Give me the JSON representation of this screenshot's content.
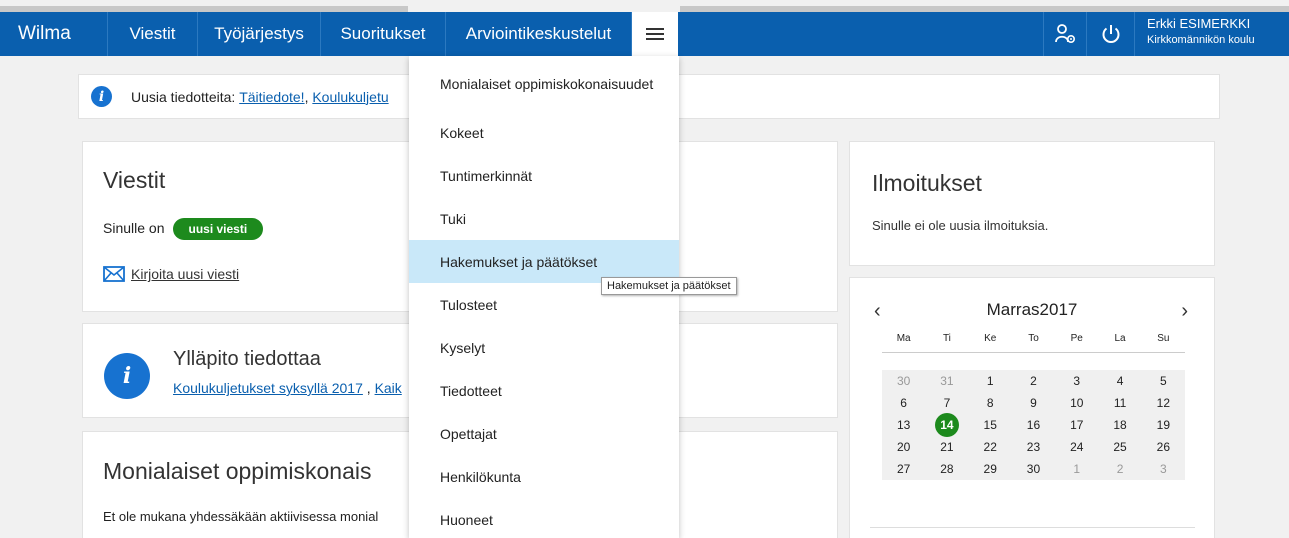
{
  "nav": {
    "brand": "Wilma",
    "items": [
      "Viestit",
      "Työjärjestys",
      "Suoritukset",
      "Arviointikeskustelut"
    ],
    "user_name": "Erkki ESIMERKKI",
    "user_school": "Kirkkomännikön koulu"
  },
  "notice": {
    "prefix": "Uusia tiedotteita:",
    "link1": "Täitiedote!",
    "sep": ",",
    "link2": "Koulukuljetu"
  },
  "messages": {
    "title": "Viestit",
    "text": "Sinulle on",
    "badge": "uusi viesti",
    "compose": "Kirjoita uusi viesti"
  },
  "admin": {
    "title": "Ylläpito tiedottaa",
    "link1": "Koulukuljetukset syksyllä 2017",
    "sep": ",",
    "link2": "Kaik"
  },
  "multi": {
    "title": "Monialaiset oppimiskonais",
    "text": "Et ole mukana yhdessäkään aktiivisessa monial"
  },
  "notifications": {
    "title": "Ilmoitukset",
    "text": "Sinulle ei ole uusia ilmoituksia."
  },
  "dropdown": {
    "items": [
      "Monialaiset oppimiskokonaisuudet",
      "Kokeet",
      "Tuntimerkinnät",
      "Tuki",
      "Hakemukset ja päätökset",
      "Tulosteet",
      "Kyselyt",
      "Tiedotteet",
      "Opettajat",
      "Henkilökunta",
      "Huoneet"
    ],
    "tooltip": "Hakemukset ja päätökset"
  },
  "calendar": {
    "month": "Marras",
    "year": "2017",
    "prev": "‹",
    "next": "›",
    "dow": [
      "Ma",
      "Ti",
      "Ke",
      "To",
      "Pe",
      "La",
      "Su"
    ],
    "weeks": [
      [
        "30",
        "31",
        "1",
        "2",
        "3",
        "4",
        "5"
      ],
      [
        "6",
        "7",
        "8",
        "9",
        "10",
        "11",
        "12"
      ],
      [
        "13",
        "14",
        "15",
        "16",
        "17",
        "18",
        "19"
      ],
      [
        "20",
        "21",
        "22",
        "23",
        "24",
        "25",
        "26"
      ],
      [
        "27",
        "28",
        "29",
        "30",
        "1",
        "2",
        "3"
      ]
    ],
    "today": "14"
  },
  "colors": {
    "nav": "#0a5fae",
    "badge": "#1d8a1d",
    "highlight": "#c9e8f9"
  }
}
